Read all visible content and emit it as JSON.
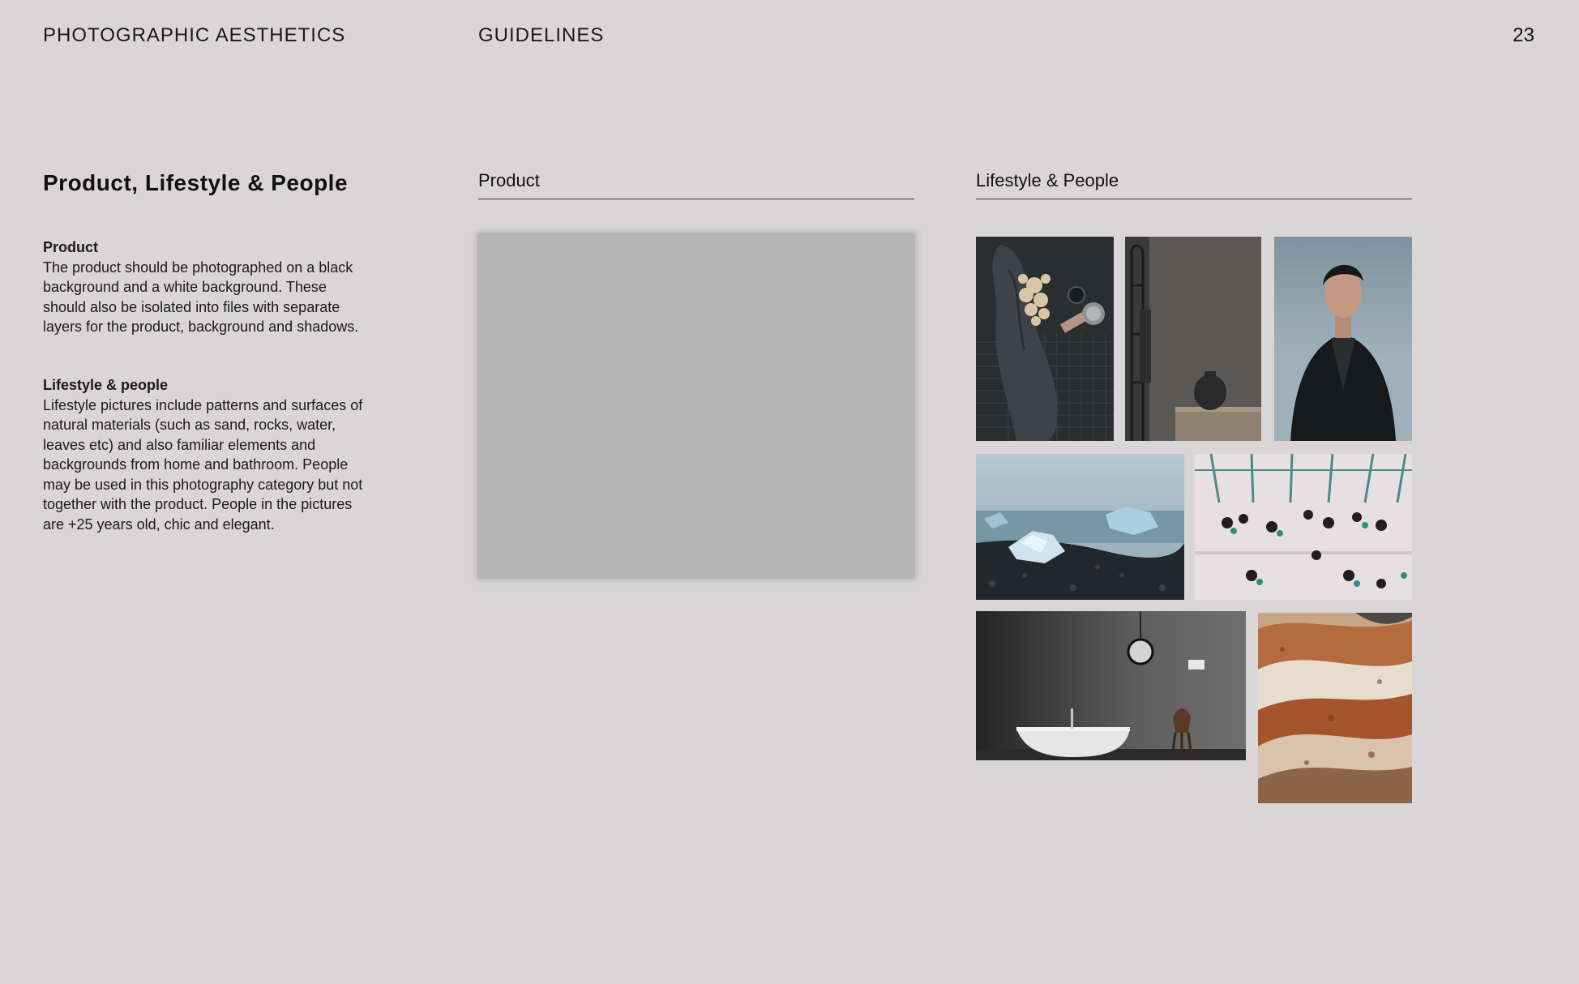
{
  "header": {
    "section": "PHOTOGRAPHIC AESTHETICS",
    "chapter": "GUIDELINES",
    "page_number": "23"
  },
  "main": {
    "title": "Product, Lifestyle & People",
    "product": {
      "label": "Product",
      "text": "The product should be photographed on a black background and a white background. These should also be isolated into files with separate layers for the product, background and shadows."
    },
    "lifestyle": {
      "label": "Lifestyle & people",
      "text": "Lifestyle pictures include patterns and surfaces of natural materials (such as sand, rocks, water, leaves etc) and also familiar elements and backgrounds from home and bathroom. People may be used in this photography category but not together with the product. People in the pictures are +25 years old, chic and elegant."
    }
  },
  "columns": {
    "product_title": "Product",
    "lifestyle_title": "Lifestyle & People"
  }
}
